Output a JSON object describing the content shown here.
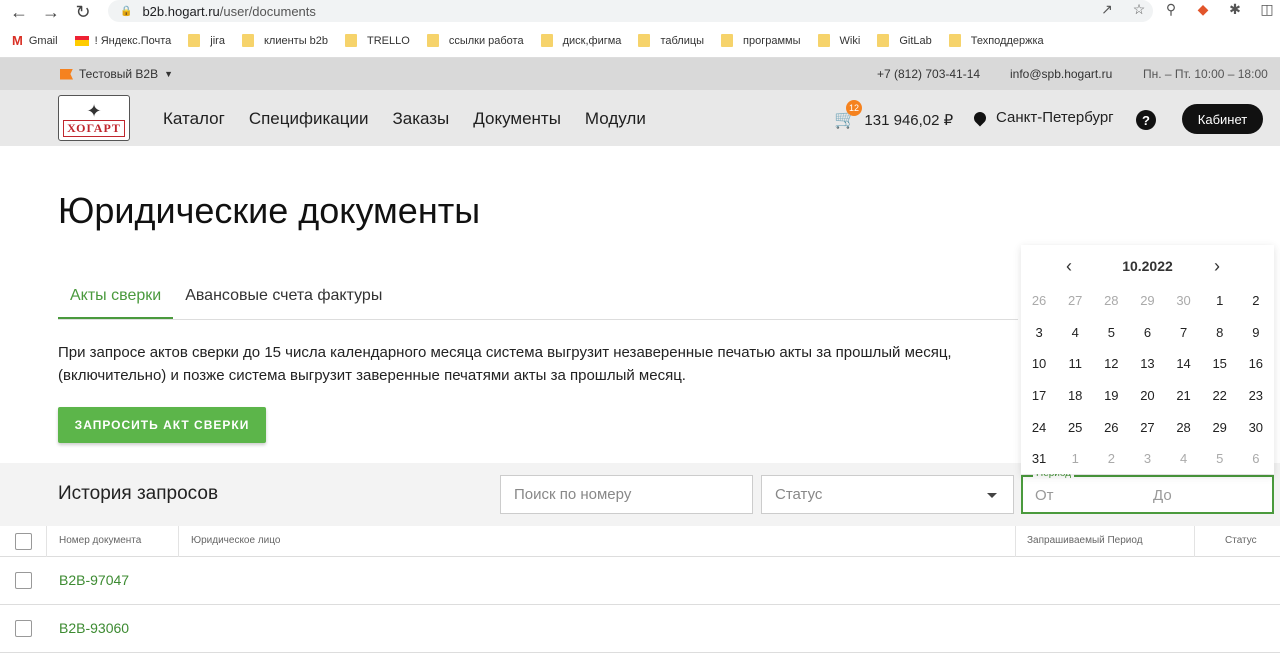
{
  "browser": {
    "url_host": "b2b.hogart.ru",
    "url_path": "/user/documents",
    "bookmarks": [
      {
        "label": "Gmail",
        "icon": "gmail-icon"
      },
      {
        "label": "! Яндекс.Почта",
        "icon": "yandex-mail-icon"
      },
      {
        "label": "jira",
        "icon": "folder-icon"
      },
      {
        "label": "клиенты b2b",
        "icon": "folder-icon"
      },
      {
        "label": "TRELLO",
        "icon": "folder-icon"
      },
      {
        "label": "ссылки работа",
        "icon": "folder-icon"
      },
      {
        "label": "диск,фигма",
        "icon": "folder-icon"
      },
      {
        "label": "таблицы",
        "icon": "folder-icon"
      },
      {
        "label": "программы",
        "icon": "folder-icon"
      },
      {
        "label": "Wiki",
        "icon": "folder-icon"
      },
      {
        "label": "GitLab",
        "icon": "folder-icon"
      },
      {
        "label": "Техподдержка",
        "icon": "folder-icon"
      }
    ]
  },
  "topbar": {
    "company": "Тестовый B2B",
    "phone": "+7 (812) 703-41-14",
    "email": "info@spb.hogart.ru",
    "hours": "Пн. – Пт. 10:00 – 18:00"
  },
  "header": {
    "logo_text": "ХОГАРТ",
    "nav": [
      "Каталог",
      "Спецификации",
      "Заказы",
      "Документы",
      "Модули"
    ],
    "cart_count": "12",
    "cart_total": "131 946,02 ₽",
    "city": "Санкт-Петербург",
    "help": "?",
    "cabinet": "Кабинет"
  },
  "page": {
    "title": "Юридические документы",
    "tabs": [
      "Акты сверки",
      "Авансовые счета фактуры"
    ],
    "notice_line1": "При запросе актов сверки до 15 числа календарного месяца система выгрузит незаверенные печатью акты за прошлый месяц,",
    "notice_line2": "(включительно) и позже система выгрузит заверенные печатями акты за прошлый месяц.",
    "request_button": "ЗАПРОСИТЬ АКТ СВЕРКИ"
  },
  "history": {
    "title": "История запросов",
    "search_placeholder": "Поиск по номеру",
    "status_placeholder": "Статус",
    "period_label": "Период",
    "period_from": "От",
    "period_to": "До",
    "columns": [
      "Номер документа",
      "Юридическое лицо",
      "Запрашиваемый Период",
      "Статус"
    ],
    "rows": [
      {
        "number": "B2B-97047"
      },
      {
        "number": "B2B-93060"
      }
    ]
  },
  "calendar": {
    "month": "10.2022",
    "weeks": [
      [
        "26",
        "27",
        "28",
        "29",
        "30",
        "1",
        "2"
      ],
      [
        "3",
        "4",
        "5",
        "6",
        "7",
        "8",
        "9"
      ],
      [
        "10",
        "11",
        "12",
        "13",
        "14",
        "15",
        "16"
      ],
      [
        "17",
        "18",
        "19",
        "20",
        "21",
        "22",
        "23"
      ],
      [
        "24",
        "25",
        "26",
        "27",
        "28",
        "29",
        "30"
      ],
      [
        "31",
        "1",
        "2",
        "3",
        "4",
        "5",
        "6"
      ]
    ],
    "muted": [
      [
        true,
        true,
        true,
        true,
        true,
        false,
        false
      ],
      [
        false,
        false,
        false,
        false,
        false,
        false,
        false
      ],
      [
        false,
        false,
        false,
        false,
        false,
        false,
        false
      ],
      [
        false,
        false,
        false,
        false,
        false,
        false,
        false
      ],
      [
        false,
        false,
        false,
        false,
        false,
        false,
        false
      ],
      [
        false,
        true,
        true,
        true,
        true,
        true,
        true
      ]
    ]
  },
  "colors": {
    "accent_green": "#4a9a3d",
    "button_green": "#5cb54a",
    "brand_orange": "#f5821f",
    "brand_red": "#c0262d"
  }
}
